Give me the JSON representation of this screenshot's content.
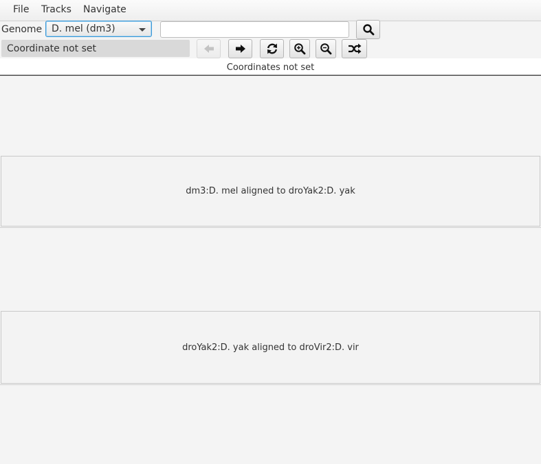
{
  "menu": {
    "file": "File",
    "tracks": "Tracks",
    "navigate": "Navigate"
  },
  "toolbar": {
    "genome_label": "Genome",
    "genome_selected": "D. mel (dm3)",
    "search_value": "",
    "search_placeholder": "",
    "coordinate_text": "Coordinate not set",
    "buttons": [
      {
        "name": "back-arrow-icon",
        "enabled": false
      },
      {
        "name": "forward-arrow-icon",
        "enabled": true
      },
      {
        "name": "refresh-icon",
        "enabled": true
      },
      {
        "name": "zoom-in-icon",
        "enabled": true
      },
      {
        "name": "zoom-out-icon",
        "enabled": true
      },
      {
        "name": "shuffle-icon",
        "enabled": true
      }
    ]
  },
  "coordinates_banner": "Coordinates not set",
  "alignments": [
    {
      "label": "dm3:D. mel aligned to droYak2:D. yak"
    },
    {
      "label": "droYak2:D. yak aligned to droVir2:D. vir"
    }
  ]
}
